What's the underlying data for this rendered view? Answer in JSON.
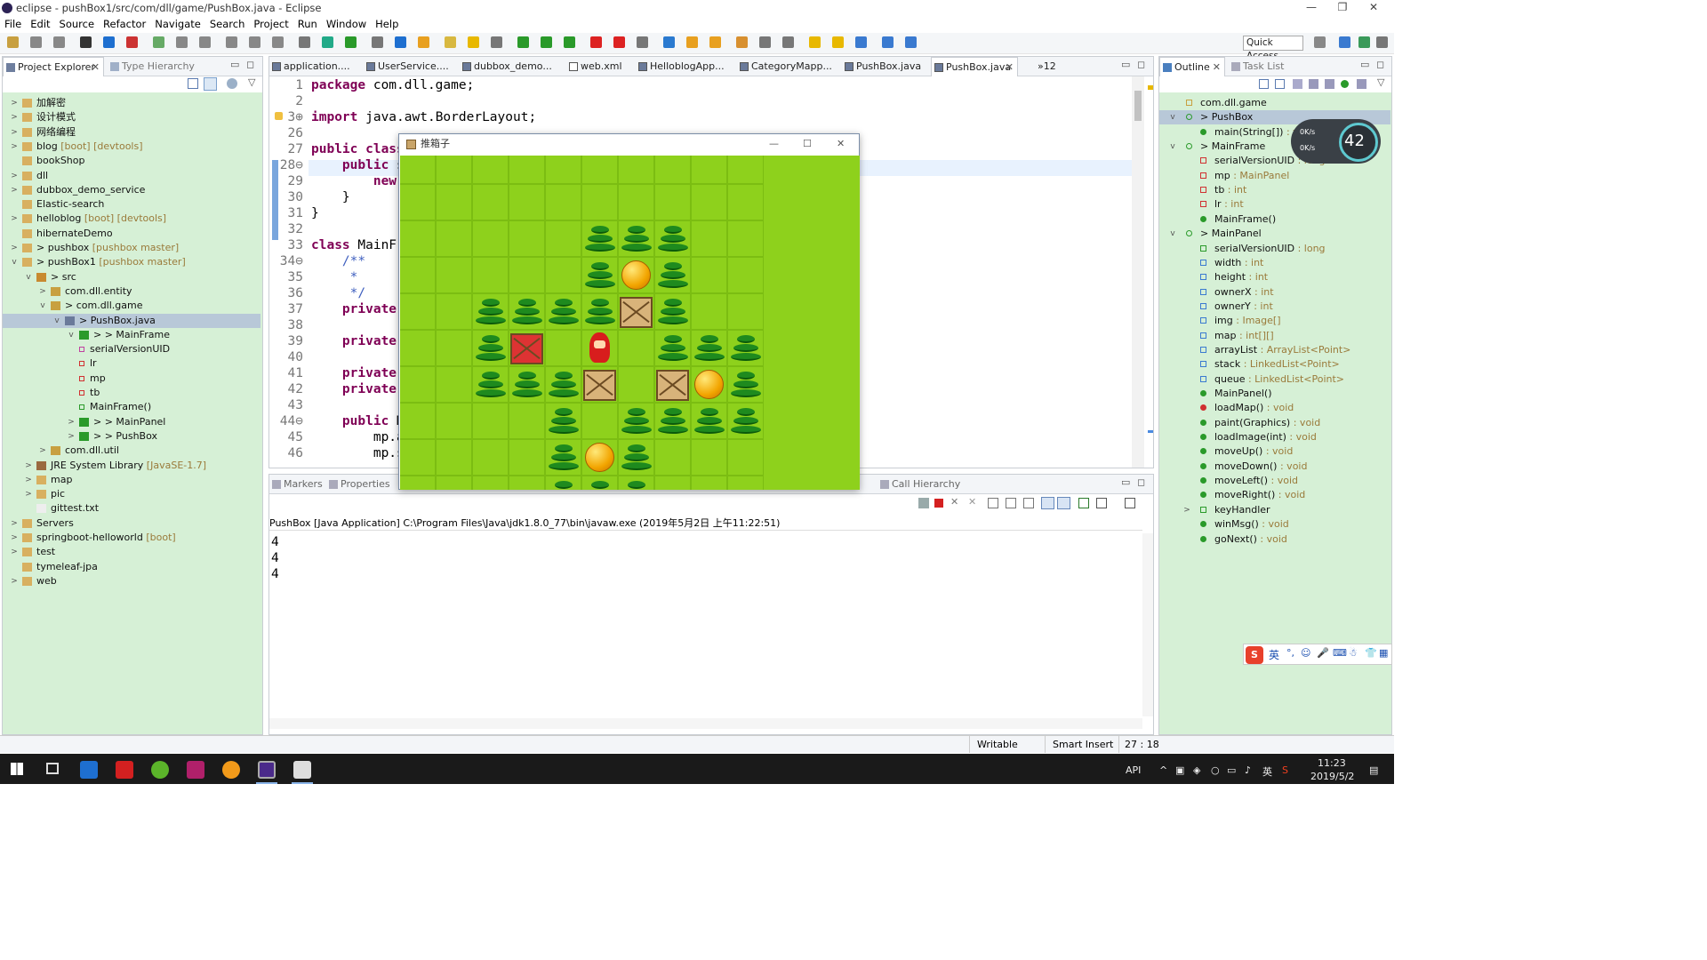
{
  "window": {
    "title": "eclipse - pushBox1/src/com/dll/game/PushBox.java - Eclipse"
  },
  "menu": [
    "File",
    "Edit",
    "Source",
    "Refactor",
    "Navigate",
    "Search",
    "Project",
    "Run",
    "Window",
    "Help"
  ],
  "quick_access": "Quick Access",
  "left_tabs": {
    "explorer": "Project Explorer",
    "hierarchy": "Type Hierarchy"
  },
  "tree": [
    {
      "label": "加解密",
      "depth": 0,
      "exp": ">"
    },
    {
      "label": "设计模式",
      "depth": 0,
      "exp": ">"
    },
    {
      "label": "网络编程",
      "depth": 0,
      "exp": ">"
    },
    {
      "label": "blog",
      "extra": "[boot] [devtools]",
      "depth": 0,
      "exp": ">"
    },
    {
      "label": "bookShop",
      "depth": 0,
      "exp": ""
    },
    {
      "label": "dll",
      "depth": 0,
      "exp": ">"
    },
    {
      "label": "dubbox_demo_service",
      "depth": 0,
      "exp": ">"
    },
    {
      "label": "Elastic-search",
      "depth": 0,
      "exp": ""
    },
    {
      "label": "helloblog",
      "extra": "[boot] [devtools]",
      "depth": 0,
      "exp": ">"
    },
    {
      "label": "hibernateDemo",
      "depth": 0,
      "exp": ""
    },
    {
      "label": "> pushbox",
      "extra": "[pushbox master]",
      "depth": 0,
      "exp": ">"
    },
    {
      "label": "> pushBox1",
      "extra": "[pushbox master]",
      "depth": 0,
      "exp": "v"
    },
    {
      "label": "> src",
      "depth": 1,
      "exp": "v"
    },
    {
      "label": "com.dll.entity",
      "depth": 2,
      "exp": ">"
    },
    {
      "label": "> com.dll.game",
      "depth": 2,
      "exp": "v"
    },
    {
      "label": "> PushBox.java",
      "depth": 3,
      "exp": "v"
    },
    {
      "label": "> > MainFrame",
      "depth": 4,
      "exp": "v"
    },
    {
      "label": "serialVersionUID",
      "depth": 5,
      "exp": ""
    },
    {
      "label": "lr",
      "depth": 5,
      "exp": ""
    },
    {
      "label": "mp",
      "depth": 5,
      "exp": ""
    },
    {
      "label": "tb",
      "depth": 5,
      "exp": ""
    },
    {
      "label": "MainFrame()",
      "depth": 5,
      "exp": ""
    },
    {
      "label": "> > MainPanel",
      "depth": 4,
      "exp": ">"
    },
    {
      "label": "> > PushBox",
      "depth": 4,
      "exp": ">"
    },
    {
      "label": "com.dll.util",
      "depth": 2,
      "exp": ">"
    },
    {
      "label": "JRE System Library",
      "extra": "[JavaSE-1.7]",
      "depth": 1,
      "exp": ">"
    },
    {
      "label": "map",
      "depth": 1,
      "exp": ">"
    },
    {
      "label": "pic",
      "depth": 1,
      "exp": ">"
    },
    {
      "label": "gittest.txt",
      "depth": 1,
      "exp": ""
    },
    {
      "label": "Servers",
      "depth": 0,
      "exp": ">"
    },
    {
      "label": "springboot-helloworld",
      "extra": "[boot]",
      "depth": 0,
      "exp": ">"
    },
    {
      "label": "test",
      "depth": 0,
      "exp": ">"
    },
    {
      "label": "tymeleaf-jpa",
      "depth": 0,
      "exp": ""
    },
    {
      "label": "web",
      "depth": 0,
      "exp": ">"
    }
  ],
  "editor_tabs": [
    "application....",
    "UserService....",
    "dubbox_demo...",
    "web.xml",
    "HelloblogApp...",
    "CategoryMapp...",
    "PushBox.java",
    "PushBox.java",
    "»12"
  ],
  "code_lines": [
    {
      "n": "1",
      "t": "package com.dll.game;"
    },
    {
      "n": "2",
      "t": ""
    },
    {
      "n": "3⊕",
      "t": "import java.awt.BorderLayout;"
    },
    {
      "n": "26",
      "t": ""
    },
    {
      "n": "27",
      "t": "public class"
    },
    {
      "n": "28⊖",
      "t": "    public st"
    },
    {
      "n": "29",
      "t": "        new M"
    },
    {
      "n": "30",
      "t": "    }"
    },
    {
      "n": "31",
      "t": "}"
    },
    {
      "n": "32",
      "t": ""
    },
    {
      "n": "33",
      "t": "class MainFra"
    },
    {
      "n": "34⊖",
      "t": "    /**"
    },
    {
      "n": "35",
      "t": "     *"
    },
    {
      "n": "36",
      "t": "     */"
    },
    {
      "n": "37",
      "t": "    private s"
    },
    {
      "n": "38",
      "t": ""
    },
    {
      "n": "39",
      "t": "    private M"
    },
    {
      "n": "40",
      "t": ""
    },
    {
      "n": "41",
      "t": "    private i"
    },
    {
      "n": "42",
      "t": "    private i"
    },
    {
      "n": "43",
      "t": ""
    },
    {
      "n": "44⊖",
      "t": "    public Ma"
    },
    {
      "n": "45",
      "t": "        mp.ad"
    },
    {
      "n": "46",
      "t": "        mp.se"
    }
  ],
  "game_window": {
    "title": "推箱子"
  },
  "game_map": [
    "..........",
    "..........",
    ".....TTT..",
    ".....TBT..",
    "..TTTTXT..",
    "..TR.H.TTT",
    "..TTTX.XBT",
    "....T.TTTT",
    "....TBT...",
    "....TTT..."
  ],
  "console_tabs": [
    "Markers",
    "Properties",
    "Unit",
    "Call Hierarchy"
  ],
  "console_header": "PushBox [Java Application] C:\\Program Files\\Java\\jdk1.8.0_77\\bin\\javaw.exe (2019年5月2日 上午11:22:51)",
  "console_lines": [
    "4",
    "4",
    "4"
  ],
  "outline_tabs": {
    "outline": "Outline",
    "tasks": "Task List"
  },
  "outline": [
    {
      "label": "com.dll.game",
      "type": "",
      "depth": 0
    },
    {
      "label": "> PushBox",
      "type": "",
      "depth": 0,
      "exp": "v"
    },
    {
      "label": "main(String[])",
      "type": ": void",
      "depth": 1
    },
    {
      "label": "> MainFrame",
      "type": "",
      "depth": 0,
      "exp": "v"
    },
    {
      "label": "serialVersionUID",
      "type": ": long",
      "depth": 1
    },
    {
      "label": "mp",
      "type": ": MainPanel",
      "depth": 1
    },
    {
      "label": "tb",
      "type": ": int",
      "depth": 1
    },
    {
      "label": "lr",
      "type": ": int",
      "depth": 1
    },
    {
      "label": "MainFrame()",
      "type": "",
      "depth": 1
    },
    {
      "label": "> MainPanel",
      "type": "",
      "depth": 0,
      "exp": "v"
    },
    {
      "label": "serialVersionUID",
      "type": ": long",
      "depth": 1
    },
    {
      "label": "width",
      "type": ": int",
      "depth": 1
    },
    {
      "label": "height",
      "type": ": int",
      "depth": 1
    },
    {
      "label": "ownerX",
      "type": ": int",
      "depth": 1
    },
    {
      "label": "ownerY",
      "type": ": int",
      "depth": 1
    },
    {
      "label": "img",
      "type": ": Image[]",
      "depth": 1
    },
    {
      "label": "map",
      "type": ": int[][]",
      "depth": 1
    },
    {
      "label": "arrayList",
      "type": ": ArrayList<Point>",
      "depth": 1
    },
    {
      "label": "stack",
      "type": ": LinkedList<Point>",
      "depth": 1
    },
    {
      "label": "queue",
      "type": ": LinkedList<Point>",
      "depth": 1
    },
    {
      "label": "MainPanel()",
      "type": "",
      "depth": 1
    },
    {
      "label": "loadMap()",
      "type": ": void",
      "depth": 1
    },
    {
      "label": "paint(Graphics)",
      "type": ": void",
      "depth": 1
    },
    {
      "label": "loadImage(int)",
      "type": ": void",
      "depth": 1
    },
    {
      "label": "moveUp()",
      "type": ": void",
      "depth": 1
    },
    {
      "label": "moveDown()",
      "type": ": void",
      "depth": 1
    },
    {
      "label": "moveLeft()",
      "type": ": void",
      "depth": 1
    },
    {
      "label": "moveRight()",
      "type": ": void",
      "depth": 1
    },
    {
      "label": "keyHandler",
      "type": "",
      "depth": 1,
      "exp": ">"
    },
    {
      "label": "winMsg()",
      "type": ": void",
      "depth": 1
    },
    {
      "label": "goNext()",
      "type": ": void",
      "depth": 1
    }
  ],
  "net_widget": {
    "up": "0K/s",
    "down": "0K/s",
    "pct": "42"
  },
  "status": {
    "writable": "Writable",
    "insert": "Smart Insert",
    "pos": "27 : 18"
  },
  "ime": "英",
  "taskbar": {
    "api": "API",
    "lang": "英",
    "time": "11:23",
    "date": "2019/5/2"
  }
}
